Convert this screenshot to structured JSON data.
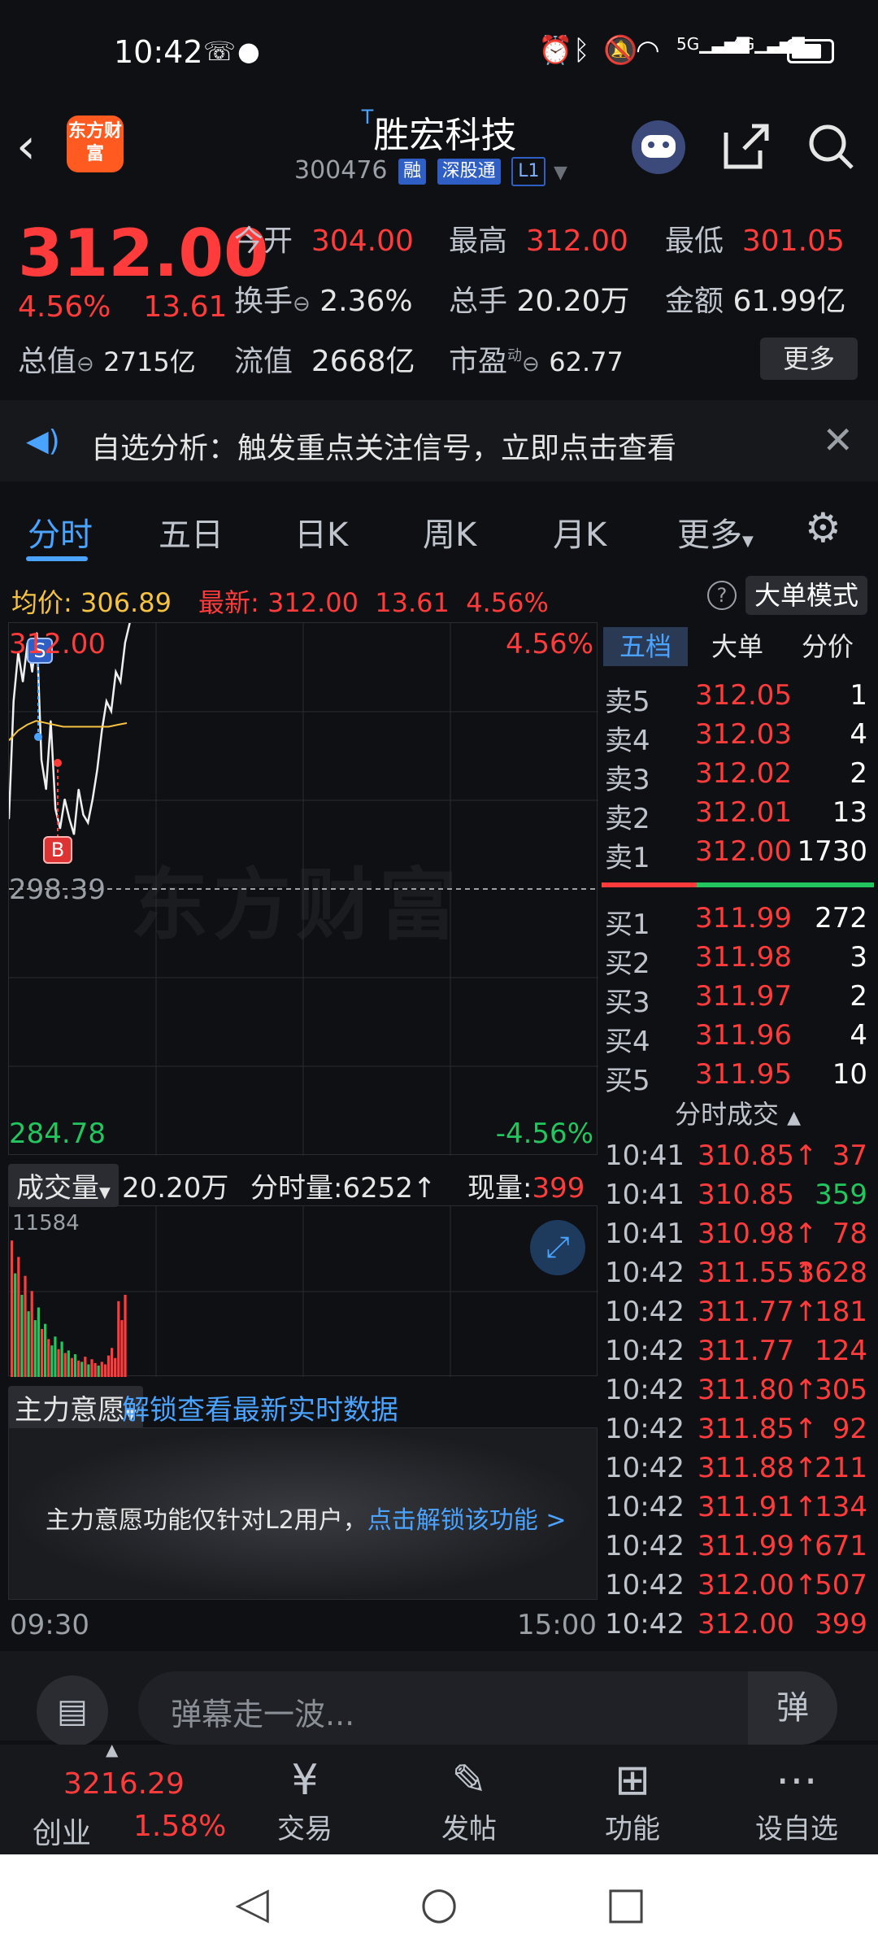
{
  "status_bar": {
    "time": "10:42",
    "icons": [
      "missed-call-icon",
      "chat-icon",
      "alarm-icon",
      "bluetooth-icon",
      "mute-icon",
      "wifi-icon",
      "5g-signal-icon",
      "4g-signal-icon",
      "battery-icon"
    ],
    "net1": "5G",
    "net2": "4G"
  },
  "header": {
    "logo": "东方财富",
    "title_sup": "T",
    "title": "胜宏科技",
    "code": "300476",
    "tags": [
      "融",
      "深股通",
      "L1"
    ]
  },
  "quote": {
    "price": "312.00",
    "pct": "4.56%",
    "change": "13.61",
    "open_label": "今开",
    "open": "304.00",
    "high_label": "最高",
    "high": "312.00",
    "low_label": "最低",
    "low": "301.05",
    "turnover_label": "换手",
    "turnover": "2.36%",
    "volume_label": "总手",
    "volume": "20.20万",
    "amount_label": "金额",
    "amount": "61.99亿",
    "mktcap_label": "总值",
    "mktcap": "2715亿",
    "float_label": "流值",
    "float": "2668亿",
    "pe_label": "市盈",
    "pe_sup": "动",
    "pe": "62.77",
    "more": "更多"
  },
  "notice": {
    "text": "自选分析：触发重点关注信号，立即点击查看"
  },
  "tabs": [
    "分时",
    "五日",
    "日K",
    "周K",
    "月K",
    "更多"
  ],
  "info": {
    "avg_label": "均价:",
    "avg": "306.89",
    "latest_label": "最新:",
    "latest": "312.00",
    "chg": "13.61",
    "pct": "4.56%",
    "mode": "大单模式"
  },
  "chart": {
    "top_price": "312.00",
    "top_pct": "4.56%",
    "mid_price": "298.39",
    "bottom_price": "284.78",
    "bottom_pct": "-4.56%",
    "watermark": "东方财富",
    "marker_s": "S",
    "marker_b": "B"
  },
  "chart_data": {
    "type": "line",
    "ylim": [
      284.78,
      312.0
    ],
    "reference": 298.39,
    "x_range": [
      "09:30",
      "15:00"
    ],
    "series": [
      {
        "values": [
          302,
          308,
          310.5,
          309,
          311,
          309.5,
          311.5,
          305,
          303.5,
          307,
          302.5,
          301.5,
          303,
          302,
          301.2,
          303.5,
          302.2,
          301.8,
          303,
          304.5,
          306.5,
          308,
          307.5,
          309.5,
          309,
          311,
          312
        ]
      },
      {
        "values": [
          306,
          306.5,
          306.8,
          307,
          306.9,
          306.8,
          306.7,
          306.7,
          306.7,
          306.7,
          306.7,
          306.7,
          306.8,
          306.89
        ]
      }
    ]
  },
  "volume": {
    "label": "成交量",
    "total": "20.20万",
    "tick_label": "分时量:",
    "tick": "6252",
    "now_label": "现量:",
    "now": "399",
    "max": "11584"
  },
  "volume_data": {
    "max": 11584,
    "bars": [
      {
        "v": 10800,
        "c": "red"
      },
      {
        "v": 8200,
        "c": "green"
      },
      {
        "v": 9500,
        "c": "red"
      },
      {
        "v": 6500,
        "c": "green"
      },
      {
        "v": 8000,
        "c": "red"
      },
      {
        "v": 5200,
        "c": "green"
      },
      {
        "v": 6800,
        "c": "red"
      },
      {
        "v": 4500,
        "c": "green"
      },
      {
        "v": 5500,
        "c": "green"
      },
      {
        "v": 3800,
        "c": "red"
      },
      {
        "v": 4200,
        "c": "green"
      },
      {
        "v": 3000,
        "c": "red"
      },
      {
        "v": 2500,
        "c": "green"
      },
      {
        "v": 3200,
        "c": "green"
      },
      {
        "v": 2200,
        "c": "red"
      },
      {
        "v": 2800,
        "c": "green"
      },
      {
        "v": 1900,
        "c": "red"
      },
      {
        "v": 2100,
        "c": "green"
      },
      {
        "v": 1500,
        "c": "red"
      },
      {
        "v": 1800,
        "c": "green"
      },
      {
        "v": 1300,
        "c": "red"
      },
      {
        "v": 1200,
        "c": "green"
      },
      {
        "v": 1600,
        "c": "red"
      },
      {
        "v": 1000,
        "c": "green"
      },
      {
        "v": 1400,
        "c": "red"
      },
      {
        "v": 1100,
        "c": "red"
      },
      {
        "v": 900,
        "c": "green"
      },
      {
        "v": 1200,
        "c": "red"
      },
      {
        "v": 1000,
        "c": "red"
      },
      {
        "v": 1700,
        "c": "red"
      },
      {
        "v": 2300,
        "c": "red"
      },
      {
        "v": 1500,
        "c": "red"
      },
      {
        "v": 6000,
        "c": "red"
      },
      {
        "v": 4500,
        "c": "red"
      },
      {
        "v": 6500,
        "c": "red"
      }
    ]
  },
  "intent": {
    "label": "主力意愿",
    "link": "解锁查看最新实时数据",
    "msg": "主力意愿功能仅针对L2用户，",
    "msg_link": "点击解锁该功能 >"
  },
  "time_axis": {
    "start": "09:30",
    "end": "15:00"
  },
  "orderbook": {
    "tabs": [
      "五档",
      "大单",
      "分价"
    ],
    "asks": [
      {
        "label": "卖5",
        "price": "312.05",
        "vol": "1"
      },
      {
        "label": "卖4",
        "price": "312.03",
        "vol": "4"
      },
      {
        "label": "卖3",
        "price": "312.02",
        "vol": "2"
      },
      {
        "label": "卖2",
        "price": "312.01",
        "vol": "13"
      },
      {
        "label": "卖1",
        "price": "312.00",
        "vol": "1730"
      }
    ],
    "bids": [
      {
        "label": "买1",
        "price": "311.99",
        "vol": "272"
      },
      {
        "label": "买2",
        "price": "311.98",
        "vol": "3"
      },
      {
        "label": "买3",
        "price": "311.97",
        "vol": "2"
      },
      {
        "label": "买4",
        "price": "311.96",
        "vol": "4"
      },
      {
        "label": "买5",
        "price": "311.95",
        "vol": "10"
      }
    ]
  },
  "ticks": {
    "header": "分时成交",
    "rows": [
      {
        "time": "10:41",
        "price": "310.85",
        "arrow": "↑",
        "vol": "37",
        "vc": "red"
      },
      {
        "time": "10:41",
        "price": "310.85",
        "arrow": "",
        "vol": "359",
        "vc": "green"
      },
      {
        "time": "10:41",
        "price": "310.98",
        "arrow": "↑",
        "vol": "78",
        "vc": "red"
      },
      {
        "time": "10:42",
        "price": "311.55",
        "arrow": "↑",
        "vol": "3628",
        "vc": "red"
      },
      {
        "time": "10:42",
        "price": "311.77",
        "arrow": "↑",
        "vol": "181",
        "vc": "red"
      },
      {
        "time": "10:42",
        "price": "311.77",
        "arrow": "",
        "vol": "124",
        "vc": "red"
      },
      {
        "time": "10:42",
        "price": "311.80",
        "arrow": "↑",
        "vol": "305",
        "vc": "red"
      },
      {
        "time": "10:42",
        "price": "311.85",
        "arrow": "↑",
        "vol": "92",
        "vc": "red"
      },
      {
        "time": "10:42",
        "price": "311.88",
        "arrow": "↑",
        "vol": "211",
        "vc": "red"
      },
      {
        "time": "10:42",
        "price": "311.91",
        "arrow": "↑",
        "vol": "134",
        "vc": "red"
      },
      {
        "time": "10:42",
        "price": "311.99",
        "arrow": "↑",
        "vol": "671",
        "vc": "red"
      },
      {
        "time": "10:42",
        "price": "312.00",
        "arrow": "↑",
        "vol": "507",
        "vc": "red"
      },
      {
        "time": "10:42",
        "price": "312.00",
        "arrow": "",
        "vol": "399",
        "vc": "red"
      }
    ]
  },
  "danmu": {
    "placeholder": "弹幕走一波...",
    "btn": "弹"
  },
  "bottom_nav": {
    "index_value": "3216.29",
    "index_name": "创业",
    "index_pct": "1.58%",
    "items": [
      {
        "label": "交易",
        "icon": "yen-icon"
      },
      {
        "label": "发帖",
        "icon": "edit-icon"
      },
      {
        "label": "功能",
        "icon": "grid-icon"
      },
      {
        "label": "设自选",
        "icon": "more-icon"
      }
    ]
  },
  "colors": {
    "up": "#ff3b3b",
    "down": "#22c55e",
    "accent": "#4aa3ff",
    "avg": "#f5c242"
  }
}
